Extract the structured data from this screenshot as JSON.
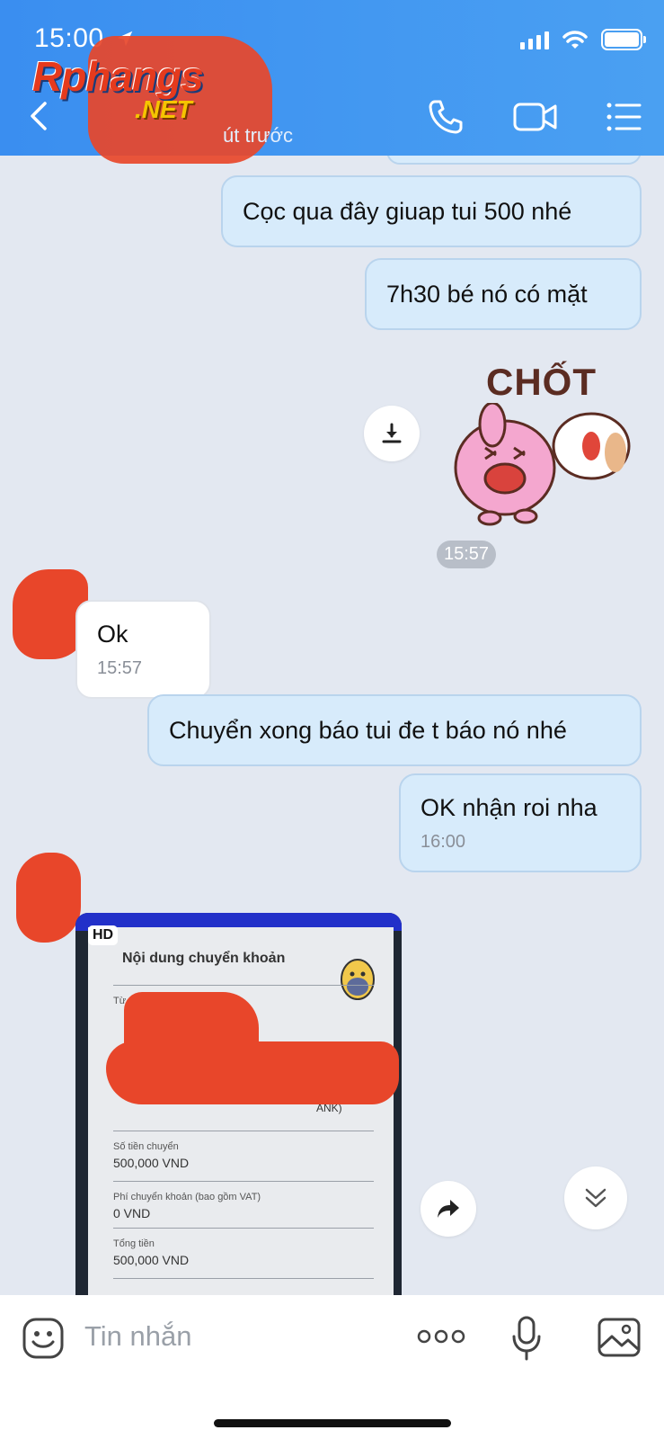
{
  "status_bar": {
    "time": "15:00"
  },
  "header": {
    "subtitle": "út trước",
    "watermark_main": "Rphangs",
    "watermark_sub": ".NET"
  },
  "messages": [
    {
      "side": "me",
      "text": "Cọc qua đây giuap tui 500 nhé"
    },
    {
      "side": "me",
      "text": "7h30 bé nó có mặt"
    },
    {
      "side": "me",
      "type": "sticker",
      "sticker_text": "CHỐT"
    },
    {
      "type": "timestamp",
      "text": "15:57"
    },
    {
      "side": "them",
      "text": "Ok",
      "time": "15:57"
    },
    {
      "side": "me",
      "text": "Chuyển xong báo tui đe t báo nó nhé"
    },
    {
      "side": "me",
      "text": "OK nhận roi nha",
      "time": "16:00"
    },
    {
      "side": "them",
      "type": "image",
      "badge": "HD"
    }
  ],
  "transfer_image": {
    "title": "Nội dung chuyển khoản",
    "from_label": "Từ",
    "bank_tag": "ANK)",
    "amount_label": "Số tiền chuyển",
    "amount_value": "500,000 VND",
    "fee_label": "Phí chuyển khoản (bao gồm VAT)",
    "fee_value": "0 VND",
    "total_label": "Tổng tiền",
    "total_value": "500,000 VND"
  },
  "input": {
    "placeholder": "Tin nhắn"
  },
  "colors": {
    "header": "#3a8ef0",
    "bubble_me": "#d7ebfb",
    "background": "#e3e8f1",
    "redaction": "#e8462a"
  }
}
